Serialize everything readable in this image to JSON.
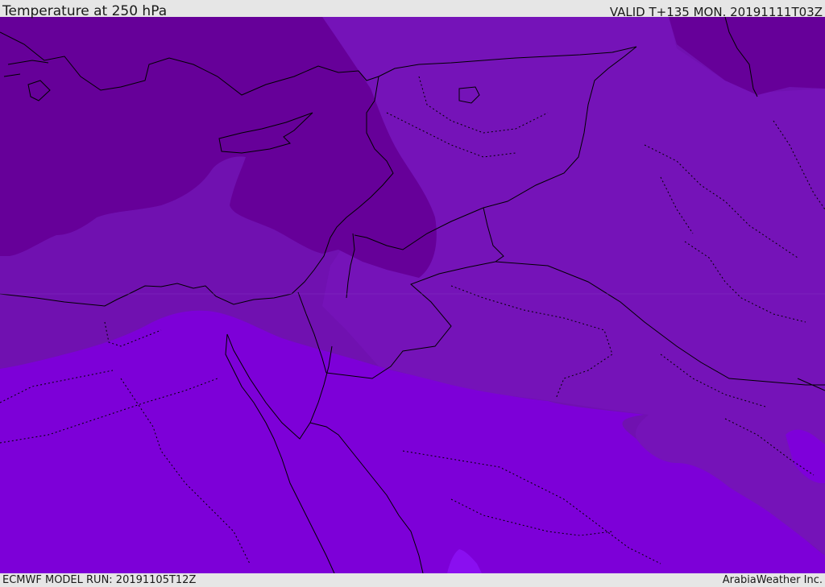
{
  "header": {
    "title": "Temperature at 250 hPa",
    "valid_time": "VALID T+135 MON. 20191111T03Z"
  },
  "footer": {
    "model_run": "ECMWF MODEL RUN: 20191105T12Z",
    "credit": "ArabiaWeather Inc."
  },
  "map": {
    "variable": "temperature",
    "level": "250 hPa",
    "colors": {
      "coldest_band": "#640096",
      "cold_band": "#7212b2",
      "mid_band": "#6f10b0",
      "warm_band": "#7d00d8",
      "warmest_patch": "#8a0ff0",
      "border_line": "#000000"
    }
  }
}
